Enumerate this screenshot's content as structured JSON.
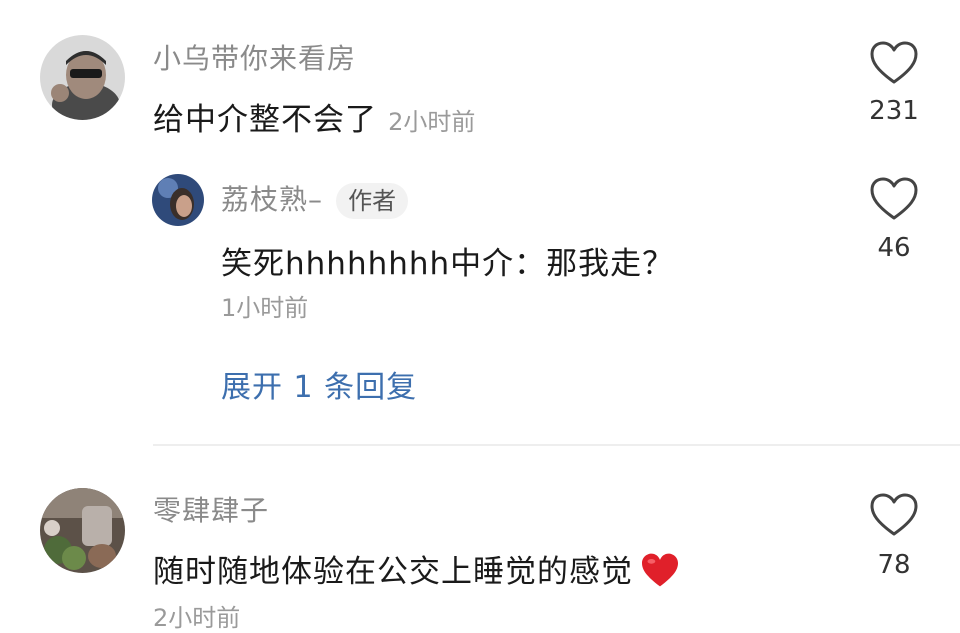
{
  "comments": [
    {
      "username": "小乌带你来看房",
      "text": "给中介整不会了",
      "time": "2小时前",
      "likes": "231"
    },
    {
      "username": "零肆肆子",
      "text": "随时随地体验在公交上睡觉的感觉",
      "emoji": "❤️",
      "time": "2小时前",
      "likes": "78"
    }
  ],
  "reply": {
    "username": "荔枝熟–",
    "badge": "作者",
    "text": "笑死hhhhhhhh中介：那我走？",
    "time": "1小时前",
    "likes": "46"
  },
  "expand_replies": "展开 1 条回复",
  "icons": {
    "like": "heart-outline-icon",
    "emoji": "red-heart-emoji"
  },
  "colors": {
    "username": "#8a8a8a",
    "link": "#3d6fae",
    "heart_emoji": "#e0202a"
  }
}
